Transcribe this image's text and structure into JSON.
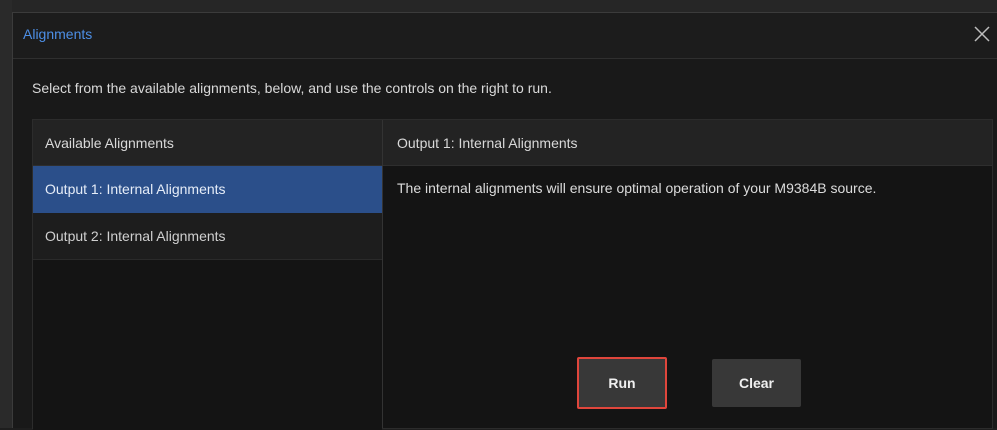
{
  "dialog": {
    "title": "Alignments",
    "instructions": "Select from the available alignments, below, and use the controls on the right to run."
  },
  "list": {
    "header": "Available Alignments",
    "items": [
      {
        "label": "Output 1: Internal Alignments",
        "selected": true
      },
      {
        "label": "Output 2: Internal Alignments",
        "selected": false
      }
    ]
  },
  "details": {
    "header": "Output 1: Internal Alignments",
    "description": "The internal alignments will ensure optimal operation of your M9384B source."
  },
  "actions": {
    "run_label": "Run",
    "clear_label": "Clear"
  },
  "colors": {
    "title_accent": "#4d8fe6",
    "selected_item": "#2b4f8a",
    "run_highlight": "#e0463c"
  },
  "icons": {
    "close": "close-icon"
  }
}
